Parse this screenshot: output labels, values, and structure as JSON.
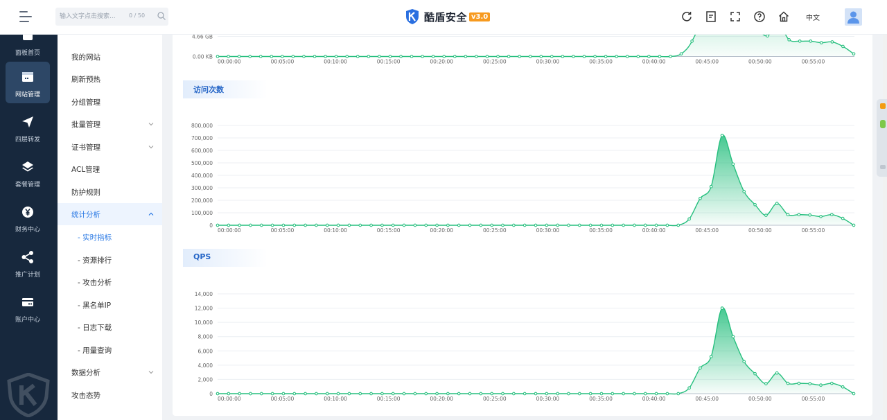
{
  "header": {
    "search_placeholder": "输入文字点击搜索...",
    "search_count": "0 / 50",
    "brand_name": "酷盾安全",
    "brand_version": "v3.0",
    "lang": "中文",
    "icons": [
      "refresh-icon",
      "notes-icon",
      "fullscreen-icon",
      "help-icon",
      "home-icon"
    ]
  },
  "rail": {
    "items": [
      {
        "label": "面板首页",
        "icon": "dashboard-icon"
      },
      {
        "label": "网站管理",
        "icon": "website-icon",
        "active": true
      },
      {
        "label": "四层转发",
        "icon": "send-icon"
      },
      {
        "label": "套餐管理",
        "icon": "layers-icon"
      },
      {
        "label": "财务中心",
        "icon": "yuan-icon"
      },
      {
        "label": "推广计划",
        "icon": "share-icon"
      },
      {
        "label": "账户中心",
        "icon": "card-icon"
      }
    ]
  },
  "submenu": {
    "items": [
      {
        "label": "我的网站"
      },
      {
        "label": "刷新预热"
      },
      {
        "label": "分组管理"
      },
      {
        "label": "批量管理",
        "chevron": "down"
      },
      {
        "label": "证书管理",
        "chevron": "down"
      },
      {
        "label": "ACL管理"
      },
      {
        "label": "防护规则"
      },
      {
        "label": "统计分析",
        "chevron": "up",
        "open": true
      },
      {
        "label": "- 实时指标",
        "child": true,
        "current": true
      },
      {
        "label": "- 资源排行",
        "child": true
      },
      {
        "label": "- 攻击分析",
        "child": true
      },
      {
        "label": "- 黑名单IP",
        "child": true
      },
      {
        "label": "- 日志下载",
        "child": true
      },
      {
        "label": "- 用量查询",
        "child": true
      },
      {
        "label": "数据分析",
        "chevron": "down"
      },
      {
        "label": "攻击态势"
      }
    ]
  },
  "sections": {
    "visits_title": "访问次数",
    "qps_title": "QPS"
  },
  "colors": {
    "accent": "#2a79e4",
    "line": "#26bf7e",
    "rail_bg": "#17283d",
    "rail_active": "#2d4766"
  },
  "chart_data": [
    {
      "type": "area",
      "title": "",
      "x_ticks": [
        "00:00:00",
        "00:05:00",
        "00:10:00",
        "00:15:00",
        "00:20:00",
        "00:25:00",
        "00:30:00",
        "00:35:00",
        "00:40:00",
        "00:45:00",
        "00:50:00",
        "00:55:00"
      ],
      "y_tick_labels": [
        "0.00 KB",
        "4.66 GB"
      ],
      "note": "partially visible (scrolled), flat until ~00:43 then peak",
      "series": [
        {
          "values": [
            0,
            0,
            0,
            0,
            0,
            0,
            0,
            0,
            0,
            0,
            0,
            0,
            0,
            0,
            0,
            0,
            0,
            0,
            0,
            0,
            0,
            0,
            0,
            0,
            0,
            0,
            0,
            0,
            0,
            0,
            0,
            0,
            0,
            0,
            0,
            0,
            0,
            0,
            0,
            0,
            0,
            0,
            0,
            0.25,
            1.45,
            4.3,
            11.5,
            14,
            7.9,
            4.4,
            2.7,
            1.95,
            3.1,
            1.58,
            1.45,
            1.45,
            1.3,
            1.38,
            0.95,
            0.25
          ]
        }
      ]
    },
    {
      "type": "area",
      "title": "访问次数",
      "x_ticks": [
        "00:00:00",
        "00:05:00",
        "00:10:00",
        "00:15:00",
        "00:20:00",
        "00:25:00",
        "00:30:00",
        "00:35:00",
        "00:40:00",
        "00:45:00",
        "00:50:00",
        "00:55:00"
      ],
      "y_ticks": [
        "0",
        "100,000",
        "200,000",
        "300,000",
        "400,000",
        "500,000",
        "600,000",
        "700,000",
        "800,000"
      ],
      "ylim": [
        0,
        800000
      ],
      "series": [
        {
          "values": [
            0,
            0,
            0,
            0,
            0,
            0,
            0,
            0,
            0,
            0,
            0,
            0,
            0,
            0,
            0,
            0,
            0,
            0,
            0,
            0,
            0,
            0,
            0,
            0,
            0,
            0,
            0,
            0,
            0,
            0,
            0,
            0,
            0,
            0,
            0,
            0,
            0,
            0,
            0,
            0,
            0,
            0,
            0,
            50000,
            215000,
            310000,
            720000,
            490000,
            270000,
            165000,
            80000,
            175000,
            85000,
            85000,
            82000,
            70000,
            85000,
            55000,
            0
          ]
        }
      ]
    },
    {
      "type": "area",
      "title": "QPS",
      "x_ticks": [
        "00:00:00",
        "00:05:00",
        "00:10:00",
        "00:15:00",
        "00:20:00",
        "00:25:00",
        "00:30:00",
        "00:35:00",
        "00:40:00",
        "00:45:00",
        "00:50:00",
        "00:55:00"
      ],
      "y_ticks": [
        "0",
        "2,000",
        "4,000",
        "6,000",
        "8,000",
        "10,000",
        "12,000",
        "14,000"
      ],
      "ylim": [
        0,
        14000
      ],
      "series": [
        {
          "values": [
            0,
            0,
            0,
            0,
            0,
            0,
            0,
            0,
            0,
            0,
            0,
            0,
            0,
            0,
            0,
            0,
            0,
            0,
            0,
            0,
            0,
            0,
            0,
            0,
            0,
            0,
            0,
            0,
            0,
            0,
            0,
            0,
            0,
            0,
            0,
            0,
            0,
            0,
            0,
            0,
            0,
            0,
            0,
            800,
            3600,
            5200,
            12000,
            8000,
            4500,
            2800,
            1400,
            2900,
            1450,
            1450,
            1400,
            1200,
            1450,
            950,
            0
          ]
        }
      ]
    }
  ]
}
